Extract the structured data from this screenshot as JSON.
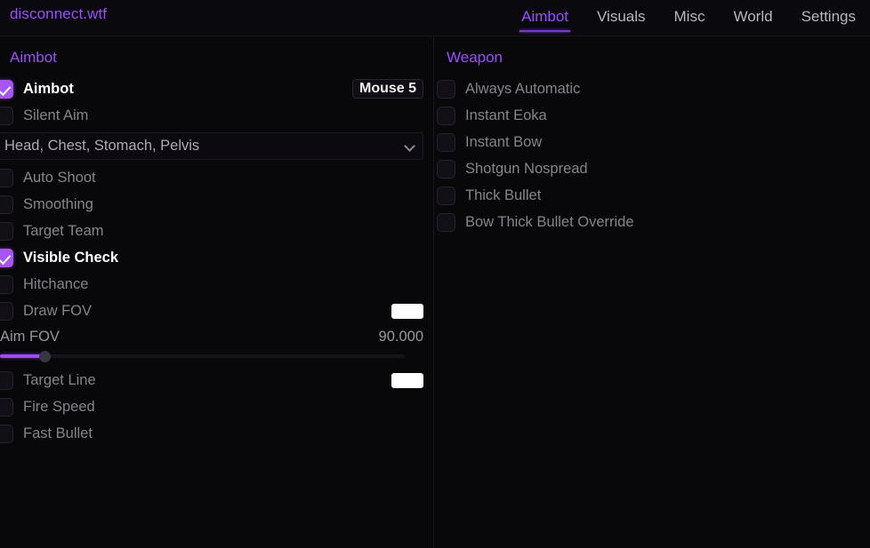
{
  "window": {
    "title": "disconnect.wtf"
  },
  "colors": {
    "accent": "#9b4dff",
    "checkbox_on": "#a855f7",
    "background": "#08070a",
    "header_background": "#0a090d",
    "label_muted": "#86848c",
    "label_active": "#ffffff",
    "swatch_white": "#ffffff"
  },
  "tabs": [
    {
      "label": "Aimbot",
      "active": true
    },
    {
      "label": "Visuals",
      "active": false
    },
    {
      "label": "Misc",
      "active": false
    },
    {
      "label": "World",
      "active": false
    },
    {
      "label": "Settings",
      "active": false
    }
  ],
  "left_panel": {
    "title": "Aimbot",
    "rows": [
      {
        "kind": "checkbox",
        "label": "Aimbot",
        "checked": true,
        "keybind": "Mouse 5"
      },
      {
        "kind": "checkbox",
        "label": "Silent Aim",
        "checked": false
      },
      {
        "kind": "dropdown",
        "value": "Head, Chest, Stomach, Pelvis",
        "icon": "chevron-down-icon"
      },
      {
        "kind": "checkbox",
        "label": "Auto Shoot",
        "checked": false
      },
      {
        "kind": "checkbox",
        "label": "Smoothing",
        "checked": false
      },
      {
        "kind": "checkbox",
        "label": "Target Team",
        "checked": false
      },
      {
        "kind": "checkbox",
        "label": "Visible Check",
        "checked": true
      },
      {
        "kind": "checkbox",
        "label": "Hitchance",
        "checked": false
      },
      {
        "kind": "checkbox",
        "label": "Draw FOV",
        "checked": false,
        "swatch": "#ffffff"
      },
      {
        "kind": "slider",
        "label": "Aim FOV",
        "value": "90.000",
        "percent": 10
      },
      {
        "kind": "checkbox",
        "label": "Target Line",
        "checked": false,
        "swatch": "#ffffff"
      },
      {
        "kind": "checkbox",
        "label": "Fire Speed",
        "checked": false
      },
      {
        "kind": "checkbox",
        "label": "Fast Bullet",
        "checked": false
      }
    ]
  },
  "right_panel": {
    "title": "Weapon",
    "rows": [
      {
        "kind": "checkbox",
        "label": "Always Automatic",
        "checked": false
      },
      {
        "kind": "checkbox",
        "label": "Instant Eoka",
        "checked": false
      },
      {
        "kind": "checkbox",
        "label": "Instant Bow",
        "checked": false
      },
      {
        "kind": "checkbox",
        "label": "Shotgun Nospread",
        "checked": false
      },
      {
        "kind": "checkbox",
        "label": "Thick Bullet",
        "checked": false
      },
      {
        "kind": "checkbox",
        "label": "Bow Thick Bullet Override",
        "checked": false
      }
    ]
  }
}
